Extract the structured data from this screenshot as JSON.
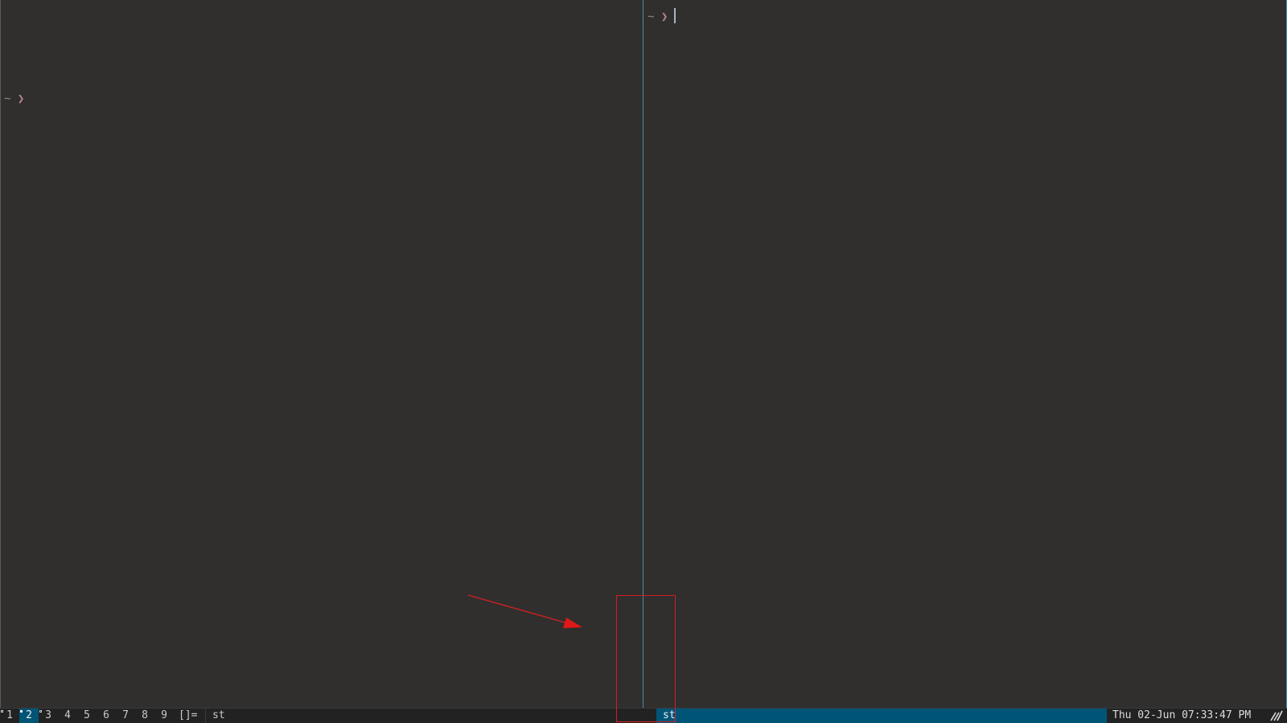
{
  "panes": {
    "left": {
      "prompt_dir": "~",
      "prompt_symbol": "❯"
    },
    "right": {
      "prompt_dir": "~",
      "prompt_symbol": "❯"
    }
  },
  "bar": {
    "tags": [
      {
        "label": "1",
        "selected": false,
        "occupied": true
      },
      {
        "label": "2",
        "selected": true,
        "occupied": true
      },
      {
        "label": "3",
        "selected": false,
        "occupied": true
      },
      {
        "label": "4",
        "selected": false,
        "occupied": false
      },
      {
        "label": "5",
        "selected": false,
        "occupied": false
      },
      {
        "label": "6",
        "selected": false,
        "occupied": false
      },
      {
        "label": "7",
        "selected": false,
        "occupied": false
      },
      {
        "label": "8",
        "selected": false,
        "occupied": false
      },
      {
        "label": "9",
        "selected": false,
        "occupied": false
      }
    ],
    "layout_symbol": "[]=",
    "left_window_title": "st",
    "active_window_title": "st",
    "clock": "Thu 02-Jun 07:33:47 PM",
    "tray_icon": "wifi-signal-icon"
  },
  "colors": {
    "background": "#302f2e",
    "bar_background": "#222222",
    "selected_accent": "#005577",
    "focus_border": "#4b8fb3",
    "prompt_symbol": "#b5869b",
    "annotation": "#d02020"
  }
}
